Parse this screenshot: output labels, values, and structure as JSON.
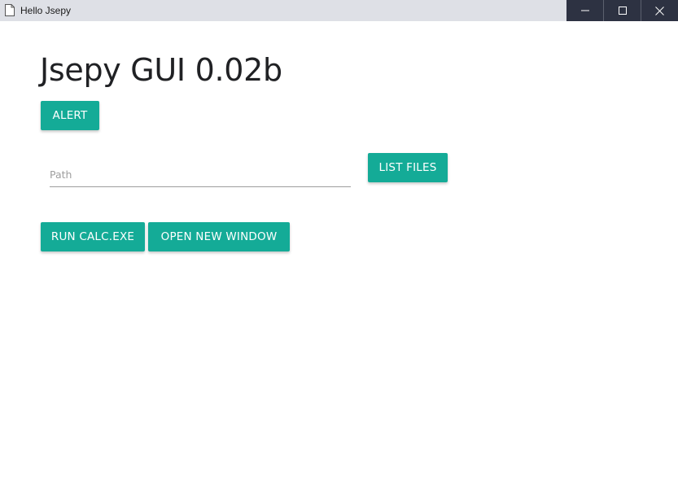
{
  "window": {
    "title": "Hello Jsepy",
    "controls": [
      "minimize-icon",
      "maximize-icon",
      "close-icon"
    ]
  },
  "main": {
    "heading": "Jsepy GUI 0.02b",
    "alert_button": "ALERT",
    "path_input": {
      "value": "",
      "placeholder": "Path"
    },
    "list_files_button": "LIST FILES",
    "run_calc_button": "RUN CALC.EXE",
    "open_window_button": "OPEN NEW WINDOW"
  },
  "colors": {
    "button_bg": "#14ab97",
    "button_text": "#ffffff",
    "titlebar_bg": "#dee0e6",
    "window_controls_bg": "#2d3242"
  }
}
